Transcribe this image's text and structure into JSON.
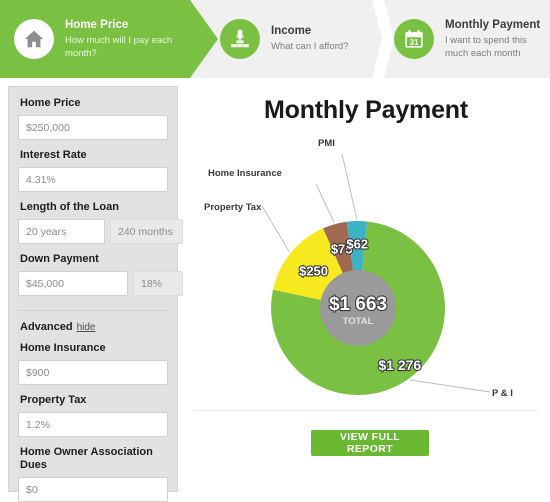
{
  "stepper": {
    "steps": [
      {
        "id": "home-price",
        "title": "Home Price",
        "subtitle": "How much will I pay each month?",
        "icon": "house-icon",
        "active": true
      },
      {
        "id": "income",
        "title": "Income",
        "subtitle": "What can I afford?",
        "icon": "money-stack-icon",
        "active": false
      },
      {
        "id": "monthly-payment",
        "title": "Monthly Payment",
        "subtitle": "I want to spend this much each month",
        "icon": "calendar-31-icon",
        "active": false
      }
    ]
  },
  "form": {
    "home_price": {
      "label": "Home Price",
      "value": "$250,000"
    },
    "interest_rate": {
      "label": "Interest Rate",
      "value": "4.31%"
    },
    "loan_length": {
      "label": "Length of the Loan",
      "years": "20 years",
      "months": "240 months"
    },
    "down_payment": {
      "label": "Down Payment",
      "amount": "$45,000",
      "percent": "18%"
    },
    "advanced": {
      "label": "Advanced",
      "toggle": "hide"
    },
    "home_insurance": {
      "label": "Home Insurance",
      "value": "$900"
    },
    "property_tax": {
      "label": "Property Tax",
      "value": "1.2%"
    },
    "hoa_dues": {
      "label": "Home Owner Association Dues",
      "value": "$0"
    }
  },
  "chart_panel": {
    "title": "Monthly Payment",
    "view_report_button": "VIEW FULL REPORT"
  },
  "chart_data": {
    "type": "pie",
    "title": "Monthly Payment",
    "center_value": "$1 663",
    "center_label": "TOTAL",
    "total": 1663,
    "labels": [
      "P & I",
      "Property Tax",
      "Home Insurance",
      "PMI"
    ],
    "values": [
      1276,
      250,
      75,
      62
    ],
    "value_labels": [
      "$1 276",
      "$250",
      "$75",
      "$62"
    ],
    "colors": [
      "#7ac143",
      "#f7e920",
      "#a06a52",
      "#3bb3c3"
    ],
    "legend": "leader-lines",
    "donut_hole": true,
    "hole_color": "#9a9a9a"
  },
  "colors": {
    "brand_green": "#7ac143",
    "button_green": "#6ab832",
    "panel_gray": "#e2e2e2",
    "header_gray": "#f0f0f0"
  }
}
